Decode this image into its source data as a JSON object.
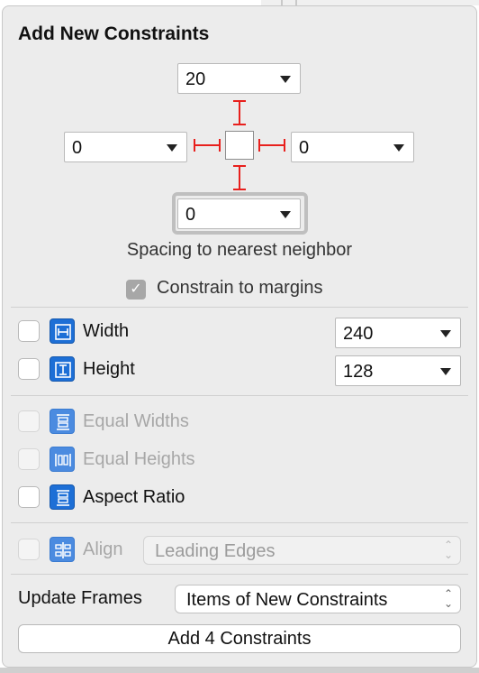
{
  "title": "Add New Constraints",
  "spacing": {
    "top": "20",
    "leading": "0",
    "trailing": "0",
    "bottom": "0",
    "caption": "Spacing to nearest neighbor"
  },
  "constrain_margins": {
    "label": "Constrain to margins",
    "checked": true
  },
  "size": {
    "width": {
      "label": "Width",
      "value": "240",
      "checked": false
    },
    "height": {
      "label": "Height",
      "value": "128",
      "checked": false
    }
  },
  "equal": {
    "widths": {
      "label": "Equal Widths",
      "enabled": false
    },
    "heights": {
      "label": "Equal Heights",
      "enabled": false
    },
    "aspect": {
      "label": "Aspect Ratio",
      "enabled": true
    }
  },
  "align": {
    "label": "Align",
    "value": "Leading Edges",
    "enabled": false
  },
  "update_frames": {
    "label": "Update Frames",
    "value": "Items of New Constraints"
  },
  "add_button": "Add 4 Constraints",
  "colors": {
    "strut": "#e8201d",
    "icon_blue": "#1d6fd6"
  }
}
